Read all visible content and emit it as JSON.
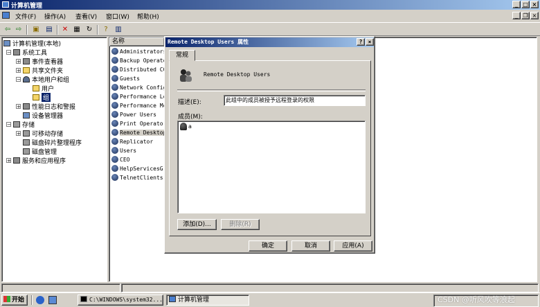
{
  "window": {
    "title": "计算机管理"
  },
  "menu": [
    "文件(F)",
    "操作(A)",
    "查看(V)",
    "窗口(W)",
    "帮助(H)"
  ],
  "tree": [
    {
      "label": "计算机管理(本地)"
    },
    {
      "label": "系统工具"
    },
    {
      "label": "事件查看器"
    },
    {
      "label": "共享文件夹"
    },
    {
      "label": "本地用户和组"
    },
    {
      "label": "用户"
    },
    {
      "label": "组"
    },
    {
      "label": "性能日志和警报"
    },
    {
      "label": "设备管理器"
    },
    {
      "label": "存储"
    },
    {
      "label": "可移动存储"
    },
    {
      "label": "磁盘碎片整理程序"
    },
    {
      "label": "磁盘管理"
    },
    {
      "label": "服务和应用程序"
    }
  ],
  "list": {
    "header": "名称",
    "items": [
      "Administrators",
      "Backup Operators",
      "Distributed COM Users",
      "Guests",
      "Network Configuration Operators",
      "Performance Log Users",
      "Performance Monitor Users",
      "Power Users",
      "Print Operators",
      "Remote Desktop Users",
      "Replicator",
      "Users",
      "CEO",
      "HelpServicesGroup",
      "TelnetClients"
    ]
  },
  "dialog": {
    "title": "Remote Desktop Users 属性",
    "tab": "常规",
    "group_name": "Remote Desktop Users",
    "desc_label": "描述(E):",
    "desc_value": "此组中的成员被授予远程登录的权限",
    "members_label": "成员(M):",
    "member": "a",
    "add_button": "添加(D)...",
    "remove_button": "删除(R)",
    "ok": "确定",
    "cancel": "取消",
    "apply": "应用(A)"
  },
  "taskbar": {
    "start": "开始",
    "task1": "C:\\WINDOWS\\system32...",
    "task2": "计算机管理"
  },
  "watermark": "CSDN @听风吹等浪起"
}
